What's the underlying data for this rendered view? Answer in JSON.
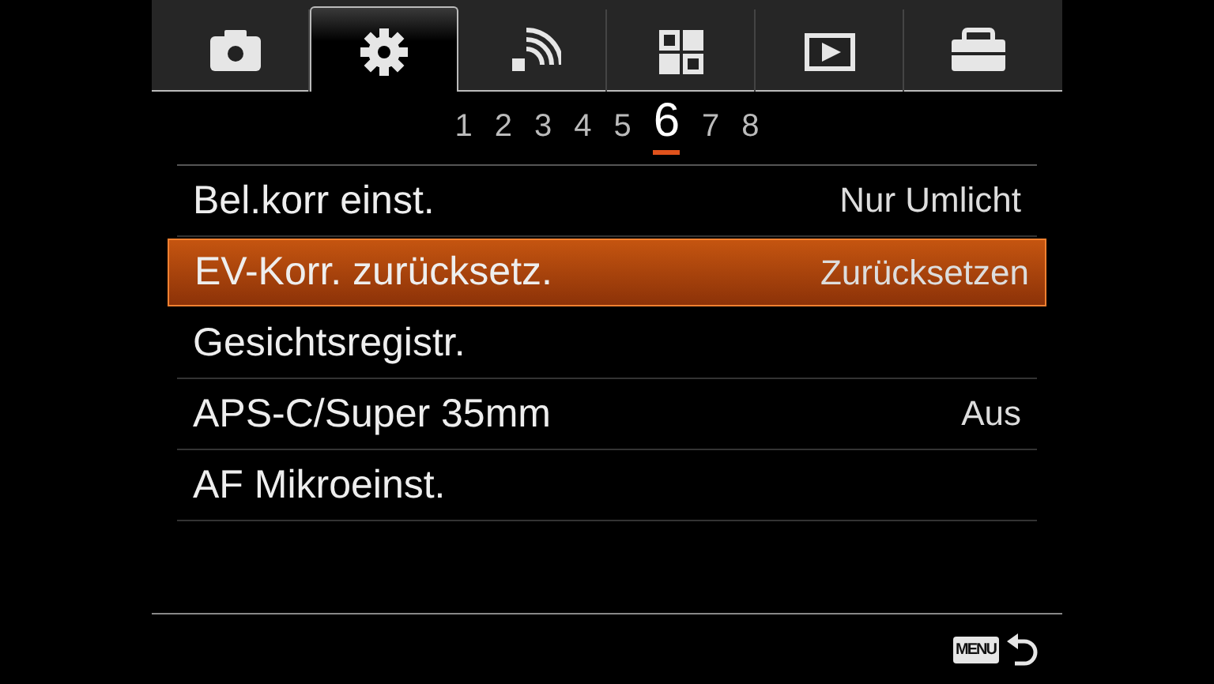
{
  "tabs": [
    {
      "kind": "camera",
      "selected": false
    },
    {
      "kind": "gear",
      "selected": true
    },
    {
      "kind": "wireless",
      "selected": false
    },
    {
      "kind": "grid",
      "selected": false
    },
    {
      "kind": "playback",
      "selected": false
    },
    {
      "kind": "toolbox",
      "selected": false
    }
  ],
  "pages": [
    {
      "label": "1",
      "selected": false
    },
    {
      "label": "2",
      "selected": false
    },
    {
      "label": "3",
      "selected": false
    },
    {
      "label": "4",
      "selected": false
    },
    {
      "label": "5",
      "selected": false
    },
    {
      "label": "6",
      "selected": true
    },
    {
      "label": "7",
      "selected": false
    },
    {
      "label": "8",
      "selected": false
    }
  ],
  "items": [
    {
      "label": "Bel.korr einst.",
      "value": "Nur Umlicht",
      "selected": false
    },
    {
      "label": "EV-Korr. zurücksetz.",
      "value": "Zurücksetzen",
      "selected": true
    },
    {
      "label": "Gesichtsregistr.",
      "selected": false
    },
    {
      "label": "APS-C/Super 35mm",
      "value": "Aus",
      "selected": false
    },
    {
      "label": "AF Mikroeinst.",
      "selected": false
    }
  ],
  "footer": {
    "menu_key": "MENU"
  }
}
